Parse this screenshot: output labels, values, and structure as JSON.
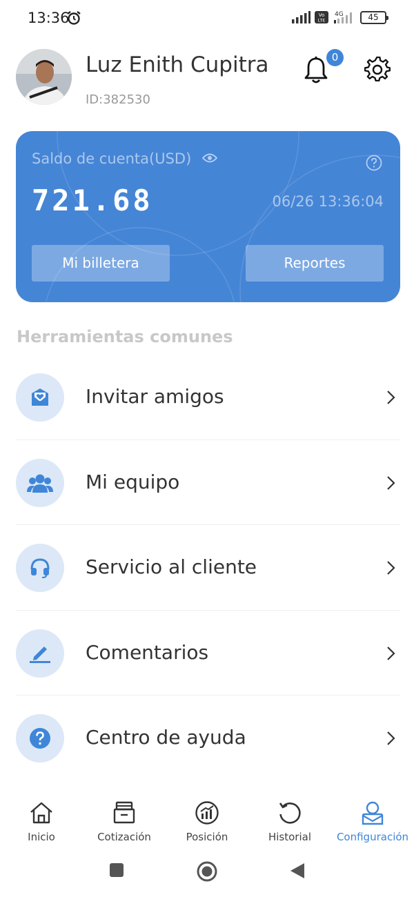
{
  "status_bar": {
    "time": "13:36",
    "battery": "45",
    "network": "4G",
    "volte": "Vo LTE"
  },
  "profile": {
    "name": "Luz Enith Cupitra",
    "id": "ID:382530",
    "notification_count": "0"
  },
  "balance_card": {
    "label": "Saldo de cuenta(USD)",
    "amount": "721.68",
    "timestamp": "06/26 13:36:04",
    "wallet_button": "Mi billetera",
    "reports_button": "Reportes",
    "color": "#4585d6"
  },
  "tools": {
    "title": "Herramientas comunes",
    "items": [
      {
        "label": "Invitar amigos",
        "icon": "invite-icon"
      },
      {
        "label": "Mi equipo",
        "icon": "team-icon"
      },
      {
        "label": "Servicio al cliente",
        "icon": "headset-icon"
      },
      {
        "label": "Comentarios",
        "icon": "pencil-icon"
      },
      {
        "label": "Centro de ayuda",
        "icon": "question-icon"
      }
    ]
  },
  "bottom_nav": {
    "items": [
      {
        "label": "Inicio",
        "icon": "home-icon"
      },
      {
        "label": "Cotización",
        "icon": "quote-icon"
      },
      {
        "label": "Posición",
        "icon": "position-icon"
      },
      {
        "label": "Historial",
        "icon": "history-icon"
      },
      {
        "label": "Configuración",
        "icon": "profile-icon",
        "active": true
      }
    ],
    "accent_color": "#3f86d8"
  }
}
